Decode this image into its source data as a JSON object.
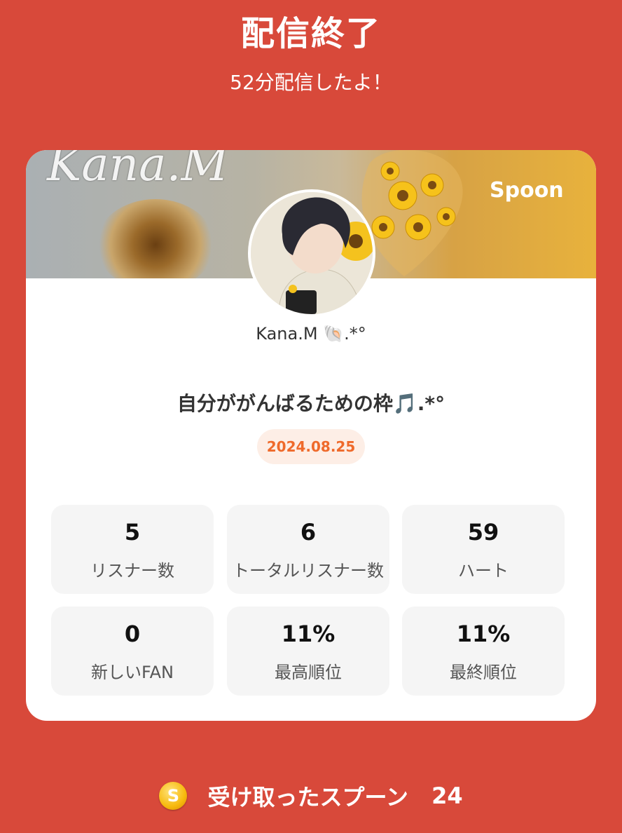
{
  "header": {
    "title": "配信終了",
    "subtitle": "52分配信したよ！"
  },
  "card": {
    "banner_text": "Kana.M",
    "brand_logo": "Spoon",
    "username": "Kana.M 🐚.*°",
    "room_title": "自分ががんばるための枠🎵.*°",
    "date": "2024.08.25",
    "stats": [
      {
        "value": "5",
        "label": "リスナー数"
      },
      {
        "value": "6",
        "label": "トータルリスナー数"
      },
      {
        "value": "59",
        "label": "ハート"
      },
      {
        "value": "0",
        "label": "新しいFAN"
      },
      {
        "value": "11%",
        "label": "最高順位"
      },
      {
        "value": "11%",
        "label": "最終順位"
      }
    ]
  },
  "footer": {
    "coin_symbol": "S",
    "label": "受け取ったスプーン",
    "count": "24"
  },
  "colors": {
    "background": "#d8493a",
    "date_accent": "#ef6a2b",
    "card": "#ffffff"
  }
}
